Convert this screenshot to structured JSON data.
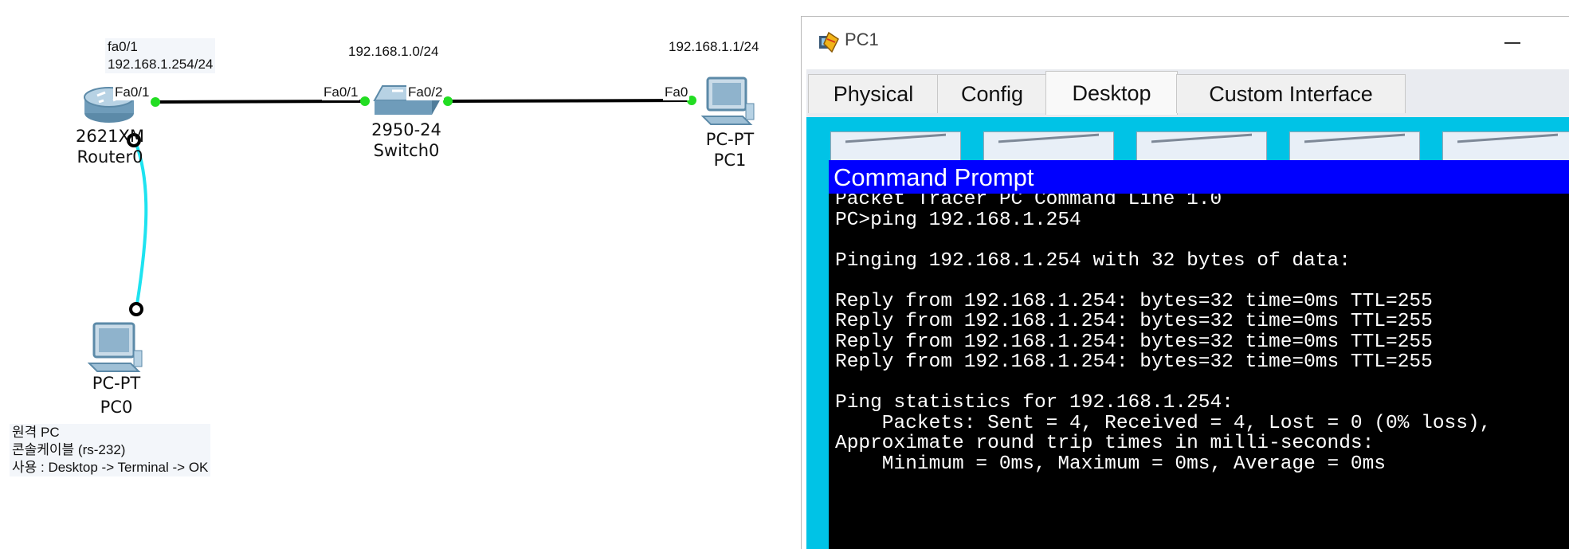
{
  "topology": {
    "router": {
      "model": "2621XM",
      "name": "Router0",
      "interface_note": "fa0/1\n192.168.1.254/24",
      "port_label": "Fa0/1"
    },
    "switch": {
      "model": "2950-24",
      "name": "Switch0",
      "network_note": "192.168.1.0/24",
      "port_left": "Fa0/1",
      "port_right": "Fa0/2"
    },
    "pc1": {
      "model": "PC-PT",
      "name": "PC1",
      "ip_note": "192.168.1.1/24",
      "port_label": "Fa0"
    },
    "pc0": {
      "model": "PC-PT",
      "name": "PC0",
      "console_note": "원격 PC\n콘솔케이블 (rs-232)\n사용 : Desktop -> Terminal -> OK"
    },
    "colors": {
      "ethernet_link": "#000000",
      "console_link": "#1ee3f0",
      "port_up": "#22dd22"
    }
  },
  "window": {
    "title": "PC1",
    "app_icon": "packet-tracer-icon",
    "minimize_icon": "minimize-icon",
    "tabs": [
      {
        "label": "Physical",
        "active": false
      },
      {
        "label": "Config",
        "active": false
      },
      {
        "label": "Desktop",
        "active": true
      },
      {
        "label": "Custom Interface",
        "active": false
      }
    ],
    "desktop_bg": "#00c3e6"
  },
  "command_prompt": {
    "title": "Command Prompt",
    "title_bg": "#0000ff",
    "console_text": "Packet Tracer PC Command Line 1.0\nPC>ping 192.168.1.254\n\nPinging 192.168.1.254 with 32 bytes of data:\n\nReply from 192.168.1.254: bytes=32 time=0ms TTL=255\nReply from 192.168.1.254: bytes=32 time=0ms TTL=255\nReply from 192.168.1.254: bytes=32 time=0ms TTL=255\nReply from 192.168.1.254: bytes=32 time=0ms TTL=255\n\nPing statistics for 192.168.1.254:\n    Packets: Sent = 4, Received = 4, Lost = 0 (0% loss),\nApproximate round trip times in milli-seconds:\n    Minimum = 0ms, Maximum = 0ms, Average = 0ms"
  }
}
